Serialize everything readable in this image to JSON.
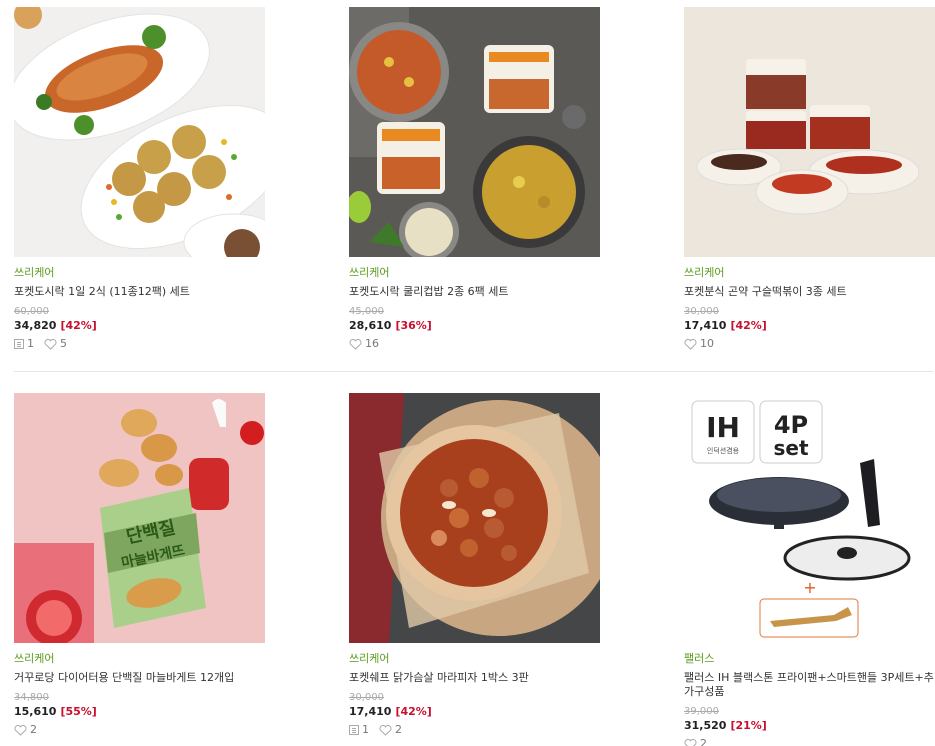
{
  "products": [
    {
      "brand": "쓰리케어",
      "title": "포켓도시락 1일 2식 (11종12팩) 세트",
      "original_price": "60,000",
      "price": "34,820",
      "discount": "[42%]",
      "reviews": "1",
      "likes": "5",
      "image": "chicken-patty-lunch-plates"
    },
    {
      "brand": "쓰리케어",
      "title": "포켓도시락 쿨리컵밥 2종 6팩 세트",
      "original_price": "45,000",
      "price": "28,610",
      "discount": "[36%]",
      "reviews": "",
      "likes": "16",
      "image": "cup-rice-bowls"
    },
    {
      "brand": "쓰리케어",
      "title": "포켓분식 곤약 구슬떡볶이 3종 세트",
      "original_price": "30,000",
      "price": "17,410",
      "discount": "[42%]",
      "reviews": "",
      "likes": "10",
      "image": "tteokbokki-cups"
    },
    {
      "brand": "쓰리케어",
      "title": "거꾸로당 다이어터용 단백질 마늘바게트 12개입",
      "original_price": "34,800",
      "price": "15,610",
      "discount": "[55%]",
      "reviews": "",
      "likes": "2",
      "image": "protein-garlic-baguette-pack",
      "pack_text": [
        "단백질",
        "마늘바게뜨"
      ]
    },
    {
      "brand": "쓰리케어",
      "title": "포켓쉐프 닭가슴살 마라피자 1박스 3판",
      "original_price": "30,000",
      "price": "17,410",
      "discount": "[42%]",
      "reviews": "1",
      "likes": "2",
      "image": "mala-chicken-pizza"
    },
    {
      "brand": "팰러스",
      "title": "팰러스 IH 블랙스톤 프라이팬+스마트핸들 3P세트+추가구성품",
      "original_price": "39,000",
      "price": "31,520",
      "discount": "[21%]",
      "reviews": "",
      "likes": "2",
      "image": "frying-pan-set",
      "badges": {
        "ih": "IH",
        "ih_sub": "인덕션겸용",
        "set_top": "4P",
        "set_bottom": "set"
      }
    }
  ],
  "colors": {
    "brand_green": "#5a9a1c",
    "discount_red": "#c8102e",
    "strike_gray": "#aaaaaa"
  },
  "icons": {
    "review": "review-doc-icon",
    "like": "heart-icon"
  }
}
